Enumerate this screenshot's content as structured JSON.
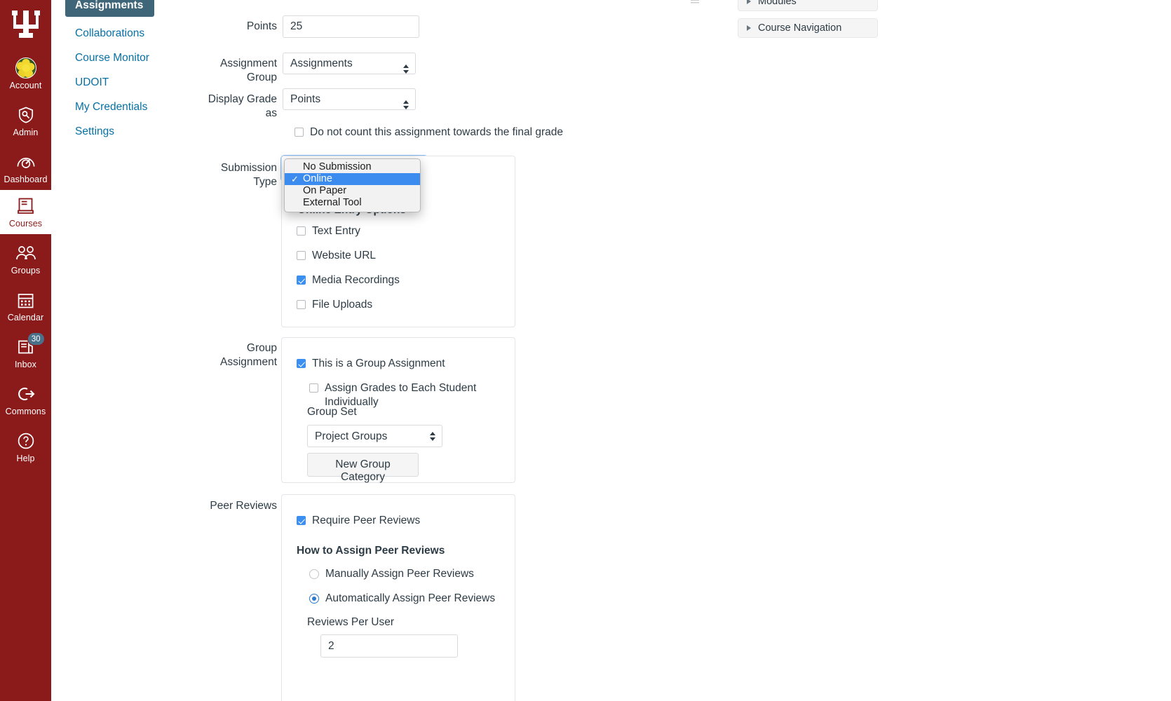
{
  "global_nav": {
    "logo_alt": "Indiana University trident logo",
    "items": [
      {
        "label": "Account",
        "icon": "avatar-icon",
        "active": false,
        "badge": null
      },
      {
        "label": "Admin",
        "icon": "shield-icon",
        "active": false,
        "badge": null
      },
      {
        "label": "Dashboard",
        "icon": "dashboard-icon",
        "active": false,
        "badge": null
      },
      {
        "label": "Courses",
        "icon": "book-icon",
        "active": true,
        "badge": null
      },
      {
        "label": "Groups",
        "icon": "groups-icon",
        "active": false,
        "badge": null
      },
      {
        "label": "Calendar",
        "icon": "calendar-icon",
        "active": false,
        "badge": null
      },
      {
        "label": "Inbox",
        "icon": "inbox-icon",
        "active": false,
        "badge": "30"
      },
      {
        "label": "Commons",
        "icon": "commons-icon",
        "active": false,
        "badge": null
      },
      {
        "label": "Help",
        "icon": "help-icon",
        "active": false,
        "badge": null
      }
    ]
  },
  "course_nav": {
    "items": [
      {
        "label": "Assignments",
        "active": true
      },
      {
        "label": "Collaborations",
        "active": false
      },
      {
        "label": "Course Monitor",
        "active": false
      },
      {
        "label": "UDOIT",
        "active": false
      },
      {
        "label": "My Credentials",
        "active": false
      },
      {
        "label": "Settings",
        "active": false
      }
    ]
  },
  "form": {
    "points": {
      "label": "Points",
      "value": "25"
    },
    "assignment_group": {
      "label": "Assignment Group",
      "value": "Assignments",
      "options": [
        "Assignments"
      ]
    },
    "display_grade_as": {
      "label": "Display Grade as",
      "value": "Points",
      "options": [
        "Points"
      ]
    },
    "do_not_count": {
      "label": "Do not count this assignment towards the final grade",
      "checked": false
    },
    "submission_type": {
      "label": "Submission Type",
      "value": "Online",
      "expanded": true,
      "options": [
        {
          "label": "No Submission",
          "selected": false
        },
        {
          "label": "Online",
          "selected": true
        },
        {
          "label": "On Paper",
          "selected": false
        },
        {
          "label": "External Tool",
          "selected": false
        }
      ]
    },
    "online_entry_options": {
      "title": "Online Entry Options",
      "items": [
        {
          "label": "Text Entry",
          "checked": false
        },
        {
          "label": "Website URL",
          "checked": false
        },
        {
          "label": "Media Recordings",
          "checked": true
        },
        {
          "label": "File Uploads",
          "checked": false
        }
      ]
    },
    "group_assignment": {
      "label": "Group Assignment",
      "is_group_assignment": {
        "label": "This is a Group Assignment",
        "checked": true
      },
      "assign_grades_individually": {
        "label": "Assign Grades to Each Student Individually",
        "checked": false
      },
      "group_set": {
        "label": "Group Set",
        "value": "Project Groups",
        "options": [
          "Project Groups"
        ]
      },
      "new_group_category_label": "New Group Category"
    },
    "peer_reviews": {
      "label": "Peer Reviews",
      "require": {
        "label": "Require Peer Reviews",
        "checked": true
      },
      "how_to_title": "How to Assign Peer Reviews",
      "radios": [
        {
          "label": "Manually Assign Peer Reviews",
          "checked": false
        },
        {
          "label": "Automatically Assign Peer Reviews",
          "checked": true
        }
      ],
      "reviews_per_user": {
        "label": "Reviews Per User",
        "value": "2"
      }
    }
  },
  "right_rail": {
    "panels": [
      {
        "label": "Modules"
      },
      {
        "label": "Course Navigation"
      }
    ]
  },
  "colors": {
    "global_nav_bg": "#8b1a1a",
    "course_nav_active_bg": "#3f6579",
    "link": "#0770A3",
    "checkbox_checked": "#3b8ff0",
    "radio_checked": "#2a7bd4",
    "dropdown_highlight": "#3c8cf0",
    "badge_bg": "#4a708a"
  }
}
